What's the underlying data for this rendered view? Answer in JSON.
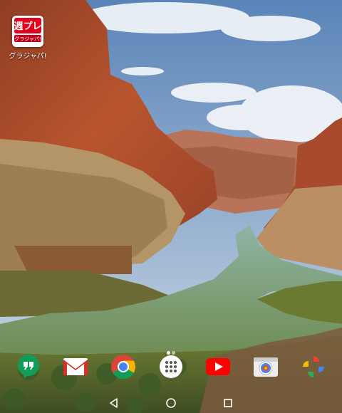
{
  "home": {
    "shortcut": {
      "label": "グラジャパ!",
      "icon": "grajapa-app-icon",
      "logo_text": "週プレ",
      "logo_sub": "グラジャパ!"
    },
    "page_indicator": {
      "pages": 2,
      "current": 1
    },
    "dock": [
      {
        "name": "hangouts",
        "icon": "hangouts-icon",
        "color": "#0f9d58"
      },
      {
        "name": "gmail",
        "icon": "gmail-icon",
        "color": "#d93025"
      },
      {
        "name": "chrome",
        "icon": "chrome-icon",
        "color": "#4285f4"
      },
      {
        "name": "app-drawer",
        "icon": "app-drawer-icon",
        "color": "#ffffff"
      },
      {
        "name": "youtube",
        "icon": "youtube-icon",
        "color": "#ff0000"
      },
      {
        "name": "camera",
        "icon": "camera-icon",
        "color": "#eeeeee"
      },
      {
        "name": "photos",
        "icon": "photos-icon",
        "color": "#fbbc05"
      }
    ]
  },
  "navbar": {
    "back": "back-icon",
    "home": "home-icon",
    "recents": "recents-icon"
  }
}
